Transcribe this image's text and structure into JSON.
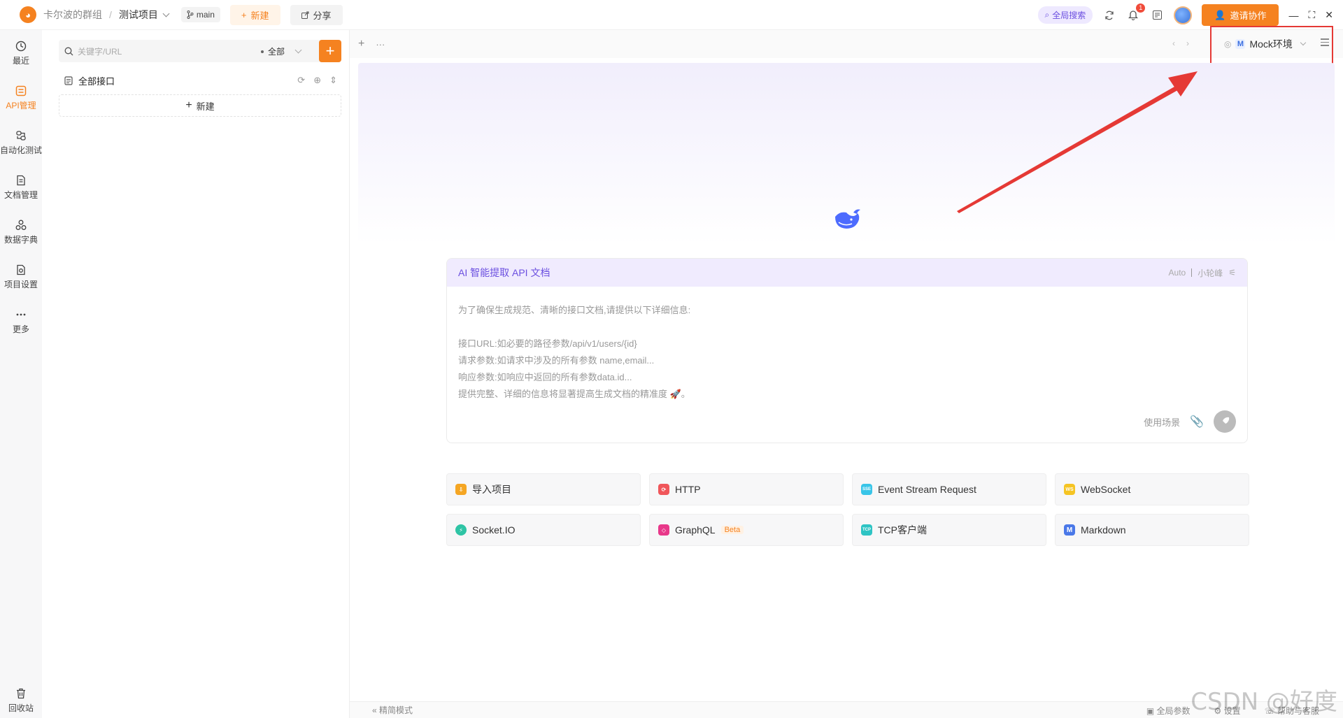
{
  "topbar": {
    "team": "卡尔波的群组",
    "separator": "/",
    "project": "测试项目",
    "branch": "main",
    "new_label": "新建",
    "share_label": "分享",
    "global_search": "全局搜索",
    "notification_count": "1",
    "invite_label": "邀请协作"
  },
  "leftnav": {
    "items": [
      {
        "label": "最近",
        "icon": "history-icon"
      },
      {
        "label": "API管理",
        "icon": "api-icon"
      },
      {
        "label": "自动化测试",
        "icon": "automation-icon"
      },
      {
        "label": "文档管理",
        "icon": "document-icon"
      },
      {
        "label": "数据字典",
        "icon": "dictionary-icon"
      },
      {
        "label": "项目设置",
        "icon": "settings-icon"
      },
      {
        "label": "更多",
        "icon": "more-icon"
      }
    ],
    "trash": "回收站"
  },
  "api_panel": {
    "search_placeholder": "关键字/URL",
    "filter": "全部",
    "all_api": "全部接口",
    "new_label": "新建"
  },
  "env": {
    "badge": "M",
    "name": "Mock环境"
  },
  "ai_card": {
    "title": "AI 智能提取 API 文档",
    "mode": "Auto",
    "model": "小轮峰",
    "lines": [
      "为了确保生成规范、清晰的接口文档,请提供以下详细信息:",
      "",
      "接口URL:如必要的路径参数/api/v1/users/{id}",
      "请求参数:如请求中涉及的所有参数 name,email...",
      "响应参数:如响应中返回的所有参数data.id...",
      "提供完整、详细的信息将显著提高生成文档的精准度 🚀。"
    ],
    "scene": "使用场景"
  },
  "quick_actions": [
    {
      "label": "导入项目",
      "icon": "import-icon",
      "color": "#f5a623",
      "glyph": "⇩"
    },
    {
      "label": "HTTP",
      "icon": "http-icon",
      "color": "#f0565a",
      "glyph": "⟳"
    },
    {
      "label": "Event Stream Request",
      "icon": "sse-icon",
      "color": "#39c5e8",
      "glyph": "SSE"
    },
    {
      "label": "WebSocket",
      "icon": "websocket-icon",
      "color": "#f5c423",
      "glyph": "WS"
    },
    {
      "label": "Socket.IO",
      "icon": "socketio-icon",
      "color": "#2ec4a5",
      "glyph": "⚡"
    },
    {
      "label": "GraphQL",
      "icon": "graphql-icon",
      "color": "#e8388a",
      "glyph": "◇",
      "badge": "Beta"
    },
    {
      "label": "TCP客户端",
      "icon": "tcp-icon",
      "color": "#2ec4c4",
      "glyph": "TCP"
    },
    {
      "label": "Markdown",
      "icon": "markdown-icon",
      "color": "#4a78e8",
      "glyph": "M"
    }
  ],
  "footer": {
    "simple_mode": "精简模式",
    "global_params": "全局参数",
    "settings": "设置",
    "help": "帮助与客服"
  },
  "watermark": "CSDN @好度",
  "colors": {
    "accent": "#f58220",
    "ai_purple": "#6b4fe0",
    "annotation_red": "#e53935"
  }
}
